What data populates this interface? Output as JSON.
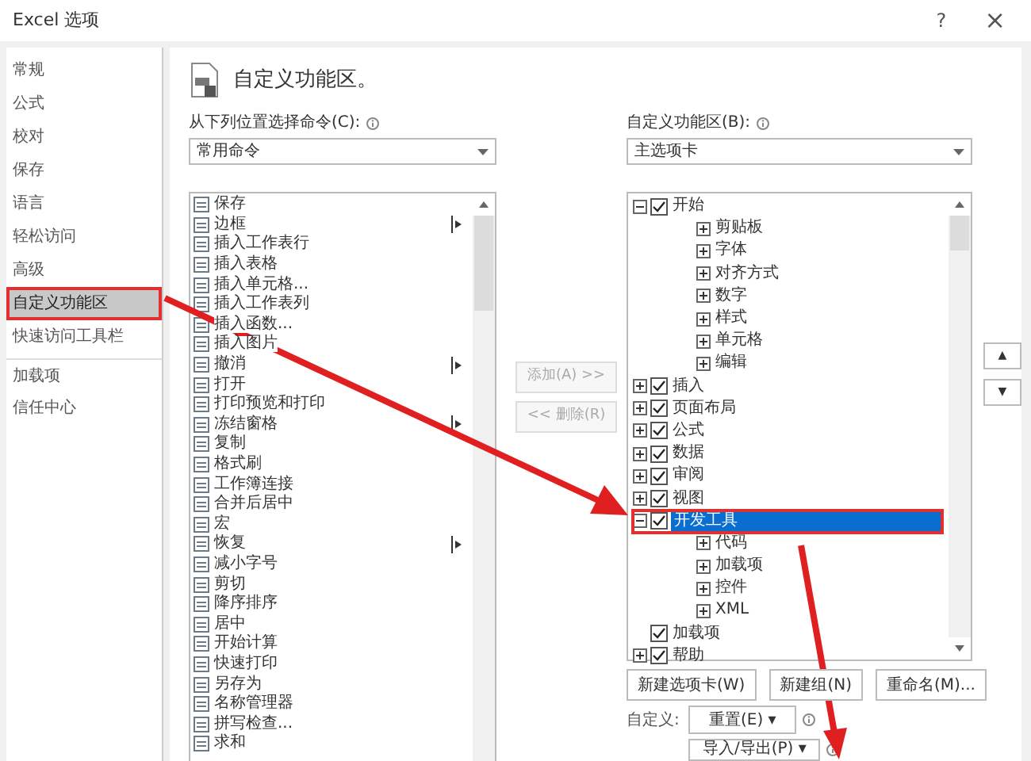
{
  "window": {
    "title": "Excel 选项",
    "help": "?",
    "close": "×"
  },
  "nav": [
    {
      "label": "常规",
      "selected": false
    },
    {
      "label": "公式",
      "selected": false
    },
    {
      "label": "校对",
      "selected": false
    },
    {
      "label": "保存",
      "selected": false
    },
    {
      "label": "语言",
      "selected": false
    },
    {
      "label": "轻松访问",
      "selected": false
    },
    {
      "label": "高级",
      "selected": false
    },
    {
      "label": "自定义功能区",
      "selected": true,
      "highlighted": true
    },
    {
      "label": "快速访问工具栏",
      "selected": false
    },
    {
      "label": "加载项",
      "selected": false
    },
    {
      "label": "信任中心",
      "selected": false
    }
  ],
  "heading": "自定义功能区。",
  "commands": {
    "label": "从下列位置选择命令(C):",
    "dropdown": "常用命令",
    "items": [
      {
        "label": "保存",
        "submenu": false
      },
      {
        "label": "边框",
        "submenu": true
      },
      {
        "label": "插入工作表行",
        "submenu": false
      },
      {
        "label": "插入表格",
        "submenu": false
      },
      {
        "label": "插入单元格...",
        "submenu": false
      },
      {
        "label": "插入工作表列",
        "submenu": false
      },
      {
        "label": "插入函数...",
        "submenu": false
      },
      {
        "label": "插入图片",
        "submenu": false
      },
      {
        "label": "撤消",
        "submenu": true
      },
      {
        "label": "打开",
        "submenu": false
      },
      {
        "label": "打印预览和打印",
        "submenu": false
      },
      {
        "label": "冻结窗格",
        "submenu": true
      },
      {
        "label": "复制",
        "submenu": false
      },
      {
        "label": "格式刷",
        "submenu": false
      },
      {
        "label": "工作簿连接",
        "submenu": false
      },
      {
        "label": "合并后居中",
        "submenu": false
      },
      {
        "label": "宏",
        "submenu": false
      },
      {
        "label": "恢复",
        "submenu": true
      },
      {
        "label": "减小字号",
        "submenu": false
      },
      {
        "label": "剪切",
        "submenu": false
      },
      {
        "label": "降序排序",
        "submenu": false
      },
      {
        "label": "居中",
        "submenu": false
      },
      {
        "label": "开始计算",
        "submenu": false
      },
      {
        "label": "快速打印",
        "submenu": false
      },
      {
        "label": "另存为",
        "submenu": false
      },
      {
        "label": "名称管理器",
        "submenu": false
      },
      {
        "label": "拼写检查...",
        "submenu": false
      },
      {
        "label": "求和",
        "submenu": false
      }
    ]
  },
  "add_button": {
    "label": "添加(A) >>",
    "disabled": true
  },
  "remove_button": {
    "label": "<< 删除(R)",
    "disabled": true
  },
  "ribbon": {
    "label": "自定义功能区(B):",
    "dropdown": "主选项卡",
    "tree": [
      {
        "label": "开始",
        "checked": true,
        "expanded": true,
        "selected": false,
        "children": [
          {
            "label": "剪贴板",
            "expanded": false
          },
          {
            "label": "字体",
            "expanded": false
          },
          {
            "label": "对齐方式",
            "expanded": false
          },
          {
            "label": "数字",
            "expanded": false
          },
          {
            "label": "样式",
            "expanded": false
          },
          {
            "label": "单元格",
            "expanded": false
          },
          {
            "label": "编辑",
            "expanded": false
          }
        ]
      },
      {
        "label": "插入",
        "checked": true,
        "expanded": false,
        "selected": false
      },
      {
        "label": "页面布局",
        "checked": true,
        "expanded": false,
        "selected": false
      },
      {
        "label": "公式",
        "checked": true,
        "expanded": false,
        "selected": false
      },
      {
        "label": "数据",
        "checked": true,
        "expanded": false,
        "selected": false
      },
      {
        "label": "审阅",
        "checked": true,
        "expanded": false,
        "selected": false
      },
      {
        "label": "视图",
        "checked": true,
        "expanded": false,
        "selected": false
      },
      {
        "label": "开发工具",
        "checked": true,
        "expanded": true,
        "selected": true,
        "highlighted": true,
        "children": [
          {
            "label": "代码",
            "expanded": false
          },
          {
            "label": "加载项",
            "expanded": false
          },
          {
            "label": "控件",
            "expanded": false
          },
          {
            "label": "XML",
            "expanded": false
          }
        ]
      },
      {
        "label": "加载项",
        "checked": true,
        "selected": false
      },
      {
        "label": "帮助",
        "checked": true,
        "expanded": false,
        "selected": false
      }
    ]
  },
  "move_up": "▲",
  "move_down": "▼",
  "buttons": [
    "新建选项卡(W)",
    "新建组(N)",
    "重命名(M)..."
  ],
  "customize_label": "自定义:",
  "reset_button": "重置(E) ▾",
  "import_export_button": "导入/导出(P) ▾"
}
